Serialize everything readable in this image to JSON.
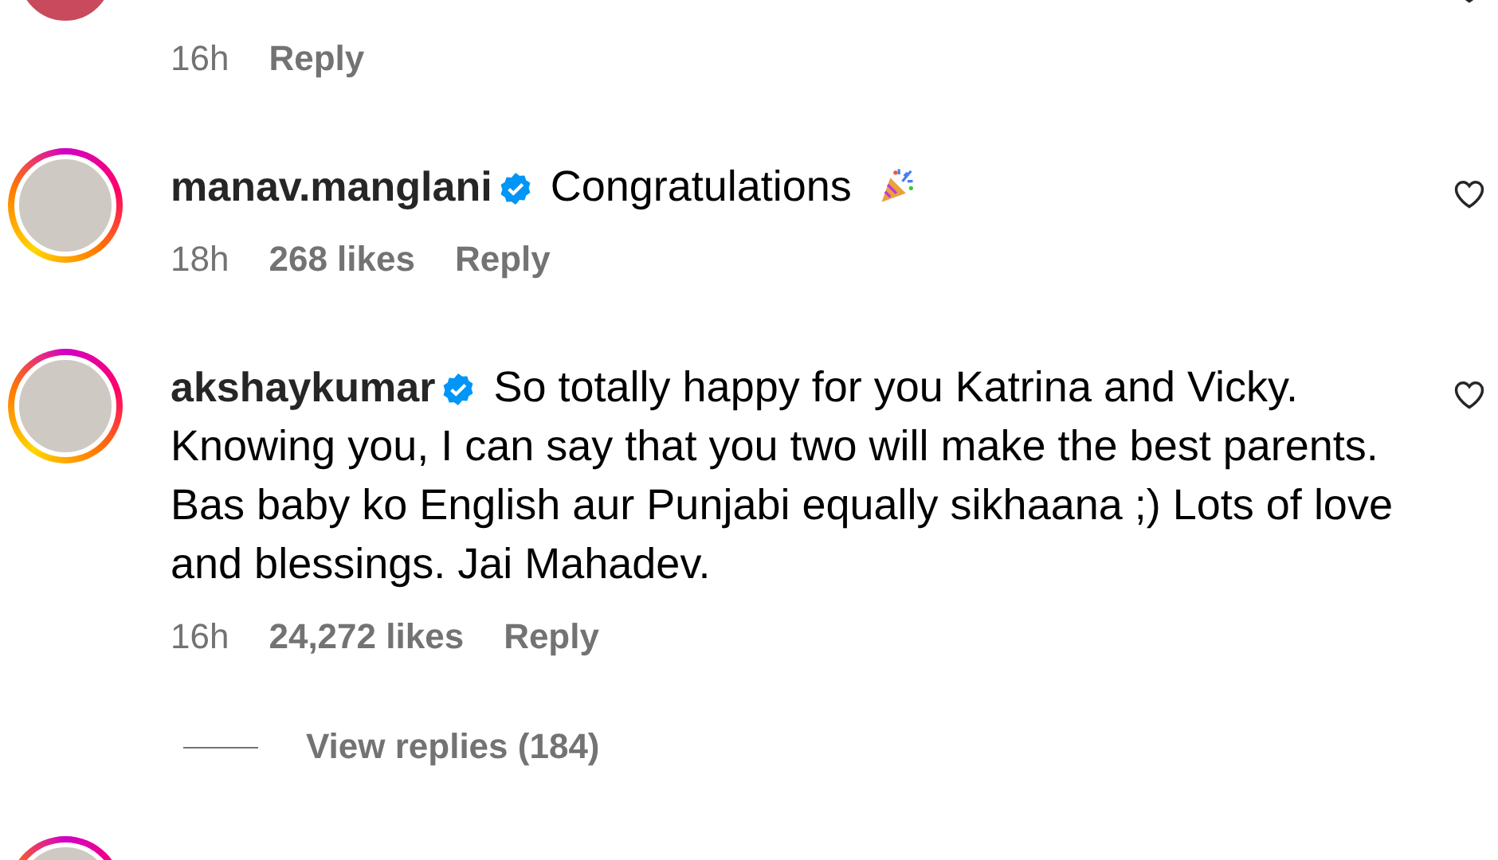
{
  "comments": [
    {
      "story_ring": false,
      "time": "16h",
      "reply": "Reply"
    },
    {
      "story_ring": true,
      "username": "manav.manglani",
      "verified": true,
      "text": "Congratulations",
      "party_emoji": true,
      "time": "18h",
      "likes": "268 likes",
      "reply": "Reply"
    },
    {
      "story_ring": true,
      "username": "akshaykumar",
      "verified": true,
      "text": "So totally happy for you Katrina and Vicky. Knowing you, I can say that you two will make the best parents. Bas baby ko English aur Punjabi equally sikhaana ;) Lots of love and blessings. Jai Mahadev.",
      "time": "16h",
      "likes": "24,272 likes",
      "reply": "Reply",
      "view_replies": "View replies (184)"
    },
    {
      "story_ring": true
    }
  ]
}
